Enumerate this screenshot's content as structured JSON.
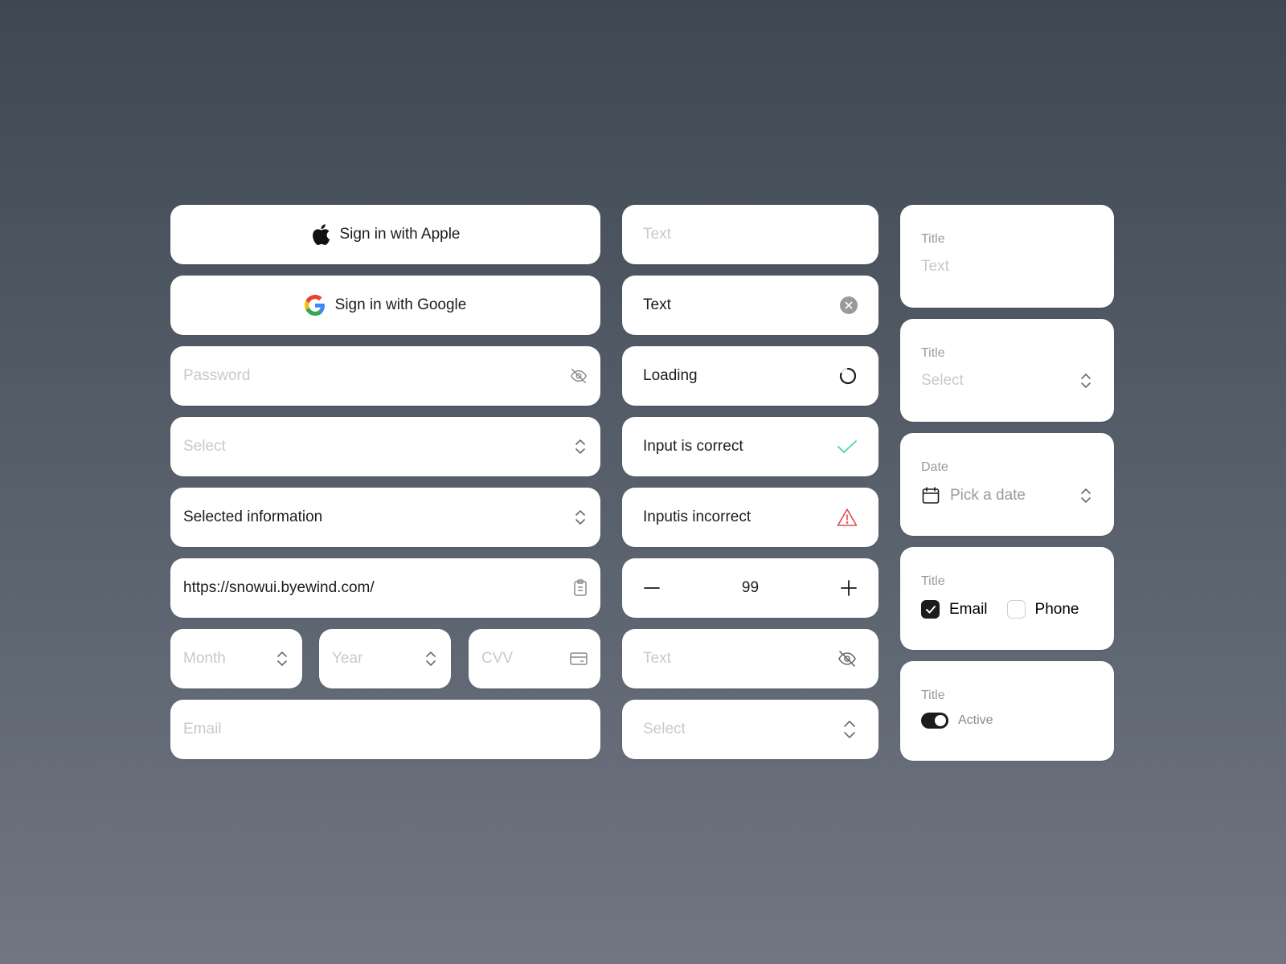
{
  "left": {
    "apple_button": "Sign in with Apple",
    "google_button": "Sign in with Google",
    "password": {
      "placeholder": "Password"
    },
    "select": {
      "placeholder": "Select"
    },
    "selected": {
      "value": "Selected information"
    },
    "url": {
      "value": "https://snowui.byewind.com/"
    },
    "month": {
      "placeholder": "Month"
    },
    "year": {
      "placeholder": "Year"
    },
    "cvv": {
      "placeholder": "CVV"
    },
    "email": {
      "placeholder": "Email"
    }
  },
  "middle": {
    "text_empty": {
      "placeholder": "Text"
    },
    "text_filled": {
      "value": "Text"
    },
    "loading": {
      "value": "Loading"
    },
    "correct": {
      "value": "Input is correct"
    },
    "incorrect": {
      "value": "Inputis incorrect"
    },
    "stepper": {
      "value": "99"
    },
    "text_hidden": {
      "placeholder": "Text"
    },
    "select": {
      "placeholder": "Select"
    }
  },
  "right": {
    "text_card": {
      "title": "Title",
      "placeholder": "Text"
    },
    "select_card": {
      "title": "Title",
      "placeholder": "Select"
    },
    "date_card": {
      "title": "Date",
      "placeholder": "Pick a date"
    },
    "checkbox_card": {
      "title": "Title",
      "options": [
        {
          "label": "Email",
          "checked": true
        },
        {
          "label": "Phone",
          "checked": false
        }
      ]
    },
    "toggle_card": {
      "title": "Title",
      "label": "Active",
      "on": true
    }
  },
  "colors": {
    "success": "#4fd1b0",
    "error": "#e5484d",
    "primary_text": "#1c1c1c",
    "placeholder": "#c9c9c9"
  },
  "icons": [
    "apple-icon",
    "google-icon",
    "eye-off-icon",
    "chevron-up-down-icon",
    "clipboard-icon",
    "credit-card-icon",
    "clear-icon",
    "loading-spinner-icon",
    "check-icon",
    "warning-icon",
    "minus-icon",
    "plus-icon",
    "calendar-icon"
  ]
}
